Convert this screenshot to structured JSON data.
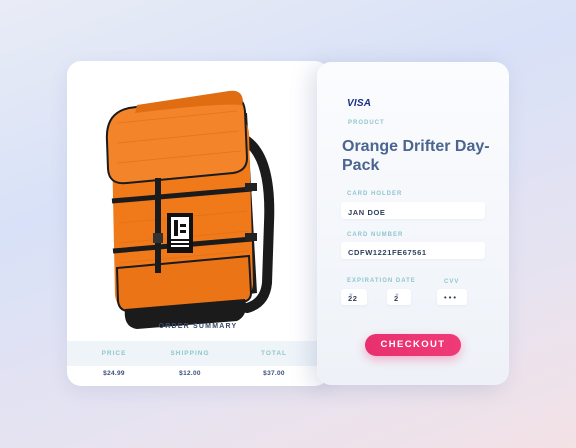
{
  "summary": {
    "title": "ORDER SUMMARY",
    "columns": [
      "PRICE",
      "SHIPPING",
      "TOTAL"
    ],
    "values": [
      "$24.99",
      "$12.00",
      "$37.00"
    ]
  },
  "payment": {
    "brand": "VISA",
    "product_label": "PRODUCT",
    "product_name": "Orange Drifter Day-Pack",
    "card_holder_label": "CARD HOLDER",
    "card_holder": "JAN DOE",
    "card_number_label": "CARD NUMBER",
    "card_number": "CDFW1221FE67561",
    "expiration_label": "EXPIRATION DATE",
    "exp_day": "22",
    "exp_month": "2",
    "cvv_label": "CVV",
    "cvv": "• • •",
    "checkout_label": "CHECKOUT"
  },
  "icons": [
    "backpack-image",
    "chevron-down-icon"
  ],
  "colors": {
    "accent": "#f03a77",
    "title": "#4a6590",
    "label": "#8fc6cf"
  }
}
